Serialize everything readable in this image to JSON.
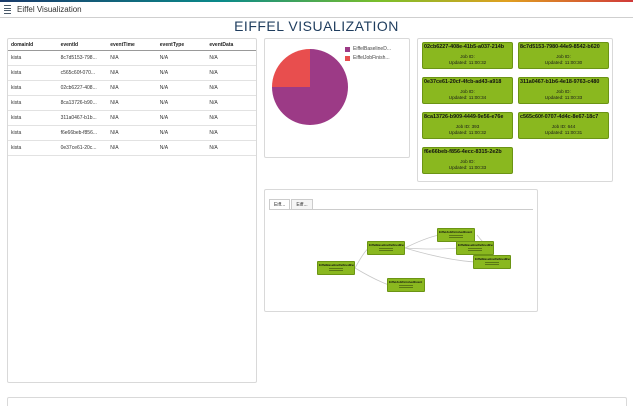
{
  "app": {
    "title": "Eiffel Visualization"
  },
  "page": {
    "title": "EIFFEL VISUALIZATION"
  },
  "table": {
    "columns": [
      "domainId",
      "eventId",
      "eventTime",
      "eventType",
      "eventData"
    ],
    "rows": [
      [
        "kista",
        "8c7d5153-798...",
        "N/A",
        "N/A",
        "N/A"
      ],
      [
        "kista",
        "c565c60f-070...",
        "N/A",
        "N/A",
        "N/A"
      ],
      [
        "kista",
        "02cb6227-408...",
        "N/A",
        "N/A",
        "N/A"
      ],
      [
        "kista",
        "8ca13726-b90...",
        "N/A",
        "N/A",
        "N/A"
      ],
      [
        "kista",
        "311a0467-b1b...",
        "N/A",
        "N/A",
        "N/A"
      ],
      [
        "kista",
        "f6e66beb-f856...",
        "N/A",
        "N/A",
        "N/A"
      ],
      [
        "kista",
        "0e37ce61-20c...",
        "N/A",
        "N/A",
        "N/A"
      ]
    ]
  },
  "pie": {
    "legend": [
      {
        "label": "EiffelBaselineD...",
        "color": "#9c3a86"
      },
      {
        "label": "EiffelJobFinish...",
        "color": "#e84e4e"
      }
    ]
  },
  "cards": [
    {
      "id": "02cb6227-408e-41b5-a037-214b",
      "job_label": "Job ID:",
      "job_value": "",
      "updated_label": "Updated:",
      "updated_value": "11:00:32"
    },
    {
      "id": "8c7d5153-7980-44e9-8542-b620",
      "job_label": "Job ID:",
      "job_value": "",
      "updated_label": "Updated:",
      "updated_value": "11:00:30"
    },
    {
      "id": "0e37ce61-20cf-4fcb-ad43-a918",
      "job_label": "Job ID:",
      "job_value": "",
      "updated_label": "Updated:",
      "updated_value": "11:00:34"
    },
    {
      "id": "311a0467-b1b6-4e18-9763-c480",
      "job_label": "Job ID:",
      "job_value": "",
      "updated_label": "Updated:",
      "updated_value": "11:00:33"
    },
    {
      "id": "8ca13726-b909-4449-9e56-e76e",
      "job_label": "Job ID:",
      "job_value": "393",
      "updated_label": "Updated:",
      "updated_value": "11:00:32"
    },
    {
      "id": "c565c60f-0707-4d4c-8e67-18c7",
      "job_label": "Job ID:",
      "job_value": "644",
      "updated_label": "Updated:",
      "updated_value": "11:00:31"
    },
    {
      "id": "f6e66beb-f856-4ecc-8315-2e2b",
      "job_label": "Job ID:",
      "job_value": "",
      "updated_label": "Updated:",
      "updated_value": "11:00:33"
    }
  ],
  "graph": {
    "tabs": [
      "Eiff...",
      "Eiff..."
    ],
    "nodes": [
      {
        "title": "EiffelBaselineDefinedEvent"
      },
      {
        "title": "EiffelBaselineDefinedEvent"
      },
      {
        "title": "EiffelJobFinishedEvent"
      },
      {
        "title": "EiffelJobFinishedEvent"
      },
      {
        "title": "EiffelBaselineDefinedEvent"
      },
      {
        "title": "EiffelBaselineDefinedEvent"
      },
      {
        "title": "EiffelJobFinishedEvent"
      }
    ]
  },
  "colors": {
    "card_green": "#8ab81f",
    "title_blue": "#1f3d5e",
    "pie_purple": "#9c3a86",
    "pie_red": "#e84e4e"
  },
  "icons": {
    "logo": "menu-lines-icon"
  }
}
